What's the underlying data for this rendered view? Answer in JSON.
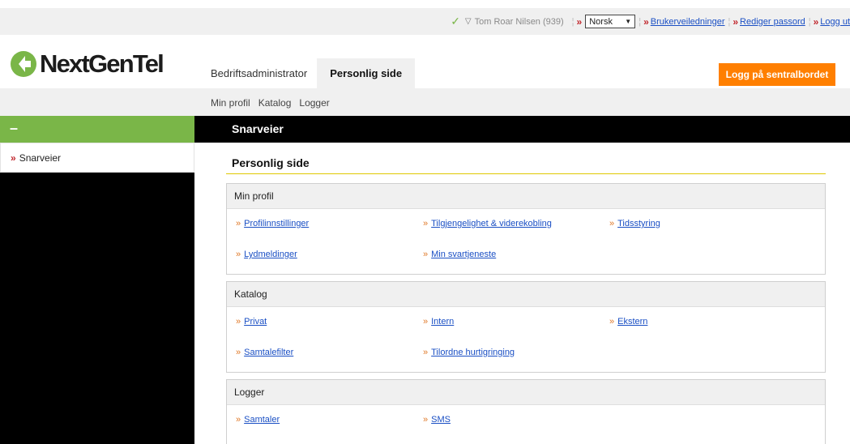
{
  "topbar": {
    "user_name": "Tom Roar Nilsen (939)",
    "language": "Norsk",
    "links": [
      "Brukerveiledninger",
      "Rediger passord",
      "Logg ut"
    ]
  },
  "logo": {
    "text": "NextGenTel"
  },
  "tabs": [
    {
      "label": "Bedriftsadministrator",
      "active": false
    },
    {
      "label": "Personlig side",
      "active": true
    }
  ],
  "login_button": "Logg på sentralbordet",
  "subnav": [
    "Min profil",
    "Katalog",
    "Logger"
  ],
  "sidebar": {
    "collapse_symbol": "–",
    "items": [
      {
        "label": "Snarveier"
      }
    ]
  },
  "main": {
    "header": "Snarveier",
    "title": "Personlig side",
    "groups": [
      {
        "title": "Min profil",
        "rows": [
          [
            "Profilinnstillinger",
            "Tilgjengelighet & viderekobling",
            "Tidsstyring"
          ],
          [
            "Lydmeldinger",
            "Min svartjeneste"
          ]
        ]
      },
      {
        "title": "Katalog",
        "rows": [
          [
            "Privat",
            "Intern",
            "Ekstern"
          ],
          [
            "Samtalefilter",
            "Tilordne hurtigringing"
          ]
        ]
      },
      {
        "title": "Logger",
        "rows": [
          [
            "Samtaler",
            "SMS"
          ]
        ]
      }
    ]
  },
  "colors": {
    "accent_green": "#7ab648",
    "login_orange": "#ff7f00",
    "link_blue": "#1a4fc4",
    "bullet_red": "#c1272d",
    "title_rule": "#e0c800"
  }
}
